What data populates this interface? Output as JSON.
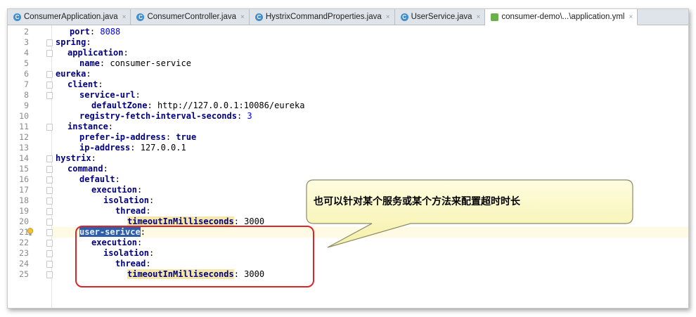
{
  "tabs": [
    {
      "label": "ConsumerApplication.java",
      "icon": "java-class-icon",
      "active": false
    },
    {
      "label": "ConsumerController.java",
      "icon": "java-class-icon",
      "active": false
    },
    {
      "label": "HystrixCommandProperties.java",
      "icon": "java-class-icon",
      "active": false
    },
    {
      "label": "UserService.java",
      "icon": "java-class-icon",
      "active": false
    },
    {
      "label": "consumer-demo\\...\\application.yml",
      "icon": "yml-file-icon",
      "active": true
    }
  ],
  "close_glyph": "×",
  "editor": {
    "line_numbers": [
      "2",
      "3",
      "4",
      "5",
      "6",
      "7",
      "8",
      "9",
      "10",
      "11",
      "12",
      "13",
      "14",
      "15",
      "16",
      "17",
      "18",
      "19",
      "20",
      "21",
      "22",
      "23",
      "24",
      "25"
    ],
    "lines": {
      "l2": {
        "key": "port",
        "value": "8088"
      },
      "l3": {
        "key": "spring"
      },
      "l4": {
        "key": "application"
      },
      "l5": {
        "key": "name",
        "value": "consumer-service"
      },
      "l6": {
        "key": "eureka"
      },
      "l7": {
        "key": "client"
      },
      "l8": {
        "key": "service-url"
      },
      "l9": {
        "key": "defaultZone",
        "value": "http://127.0.0.1:10086/eureka"
      },
      "l10": {
        "key": "registry-fetch-interval-seconds",
        "value": "3"
      },
      "l11": {
        "key": "instance"
      },
      "l12": {
        "key": "prefer-ip-address",
        "value": "true"
      },
      "l13": {
        "key": "ip-address",
        "value": "127.0.0.1"
      },
      "l14": {
        "key": "hystrix"
      },
      "l15": {
        "key": "command"
      },
      "l16": {
        "key": "default"
      },
      "l17": {
        "key": "execution"
      },
      "l18": {
        "key": "isolation"
      },
      "l19": {
        "key": "thread"
      },
      "l20": {
        "key": "timeoutInMilliseconds",
        "value": "3000"
      },
      "l21": {
        "key": "user-serivce"
      },
      "l22": {
        "key": "execution"
      },
      "l23": {
        "key": "isolation"
      },
      "l24": {
        "key": "thread"
      },
      "l25": {
        "key": "timeoutInMilliseconds",
        "value": "3000"
      }
    }
  },
  "callout": {
    "text": "也可以针对某个服务或某个方法来配置超时时长"
  },
  "colors": {
    "highlight_box": "#d9262b",
    "callout_fill": "#fdfbc3",
    "selection": "#2e5fa8"
  }
}
